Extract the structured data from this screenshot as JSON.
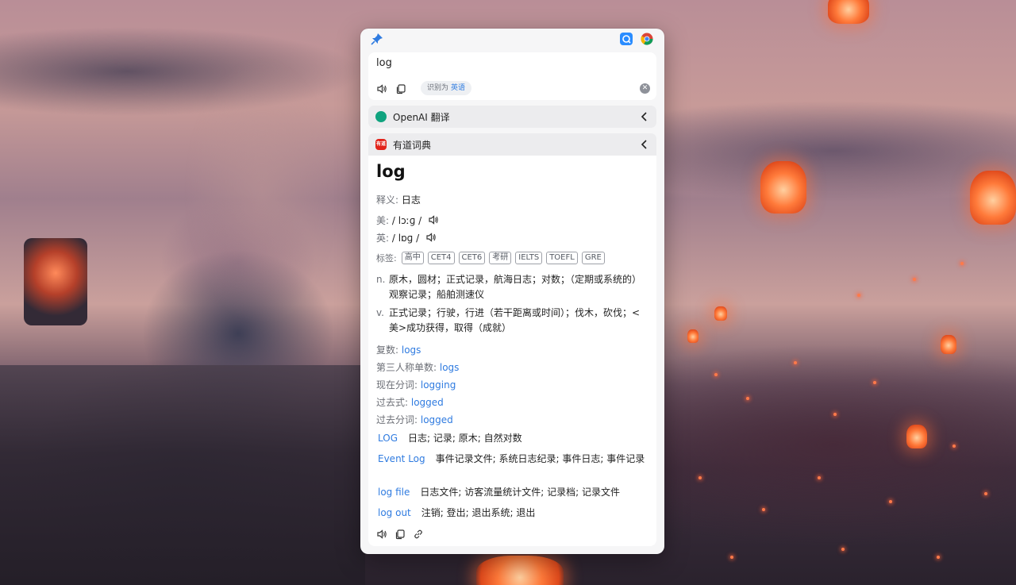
{
  "window": {
    "input": {
      "query": "log",
      "detected_prefix": "识别为",
      "detected_language": "英语"
    },
    "services": [
      {
        "name": "OpenAI 翻译"
      },
      {
        "name": "有道词典",
        "icon_text": "有道"
      }
    ],
    "youdao": {
      "word": "log",
      "meaning": {
        "label": "释义:",
        "value": "日志"
      },
      "phonetics": [
        {
          "label": "美:",
          "value": "/ lɔːɡ /"
        },
        {
          "label": "英:",
          "value": "/ lɒɡ /"
        }
      ],
      "tags_label": "标签:",
      "tags": [
        "高中",
        "CET4",
        "CET6",
        "考研",
        "IELTS",
        "TOEFL",
        "GRE"
      ],
      "definitions": [
        {
          "pos": "n.",
          "text": "原木，圆材；正式记录，航海日志；对数；（定期或系统的）观察记录；船舶测速仪"
        },
        {
          "pos": "v.",
          "text": "正式记录；行驶，行进（若干距离或时间）；伐木，砍伐；<美>成功获得，取得（成就）"
        }
      ],
      "forms": [
        {
          "label": "复数:",
          "value": "logs"
        },
        {
          "label": "第三人称单数:",
          "value": "logs"
        },
        {
          "label": "现在分词:",
          "value": "logging"
        },
        {
          "label": "过去式:",
          "value": "logged"
        },
        {
          "label": "过去分词:",
          "value": "logged"
        }
      ],
      "phrases": [
        {
          "word": "LOG",
          "meaning": "日志; 记录; 原木; 自然对数"
        },
        {
          "word": "Event Log",
          "meaning": "事件记录文件; 系统日志纪录; 事件日志; 事件记录"
        },
        {
          "word": "log file",
          "meaning": "日志文件; 访客流量统计文件; 记录档; 记录文件"
        },
        {
          "word": "log out",
          "meaning": "注销; 登出; 退出系统; 退出"
        }
      ]
    }
  },
  "colors": {
    "link": "#2f7be0",
    "openai": "#10a37f",
    "youdao": "#e2231a"
  }
}
